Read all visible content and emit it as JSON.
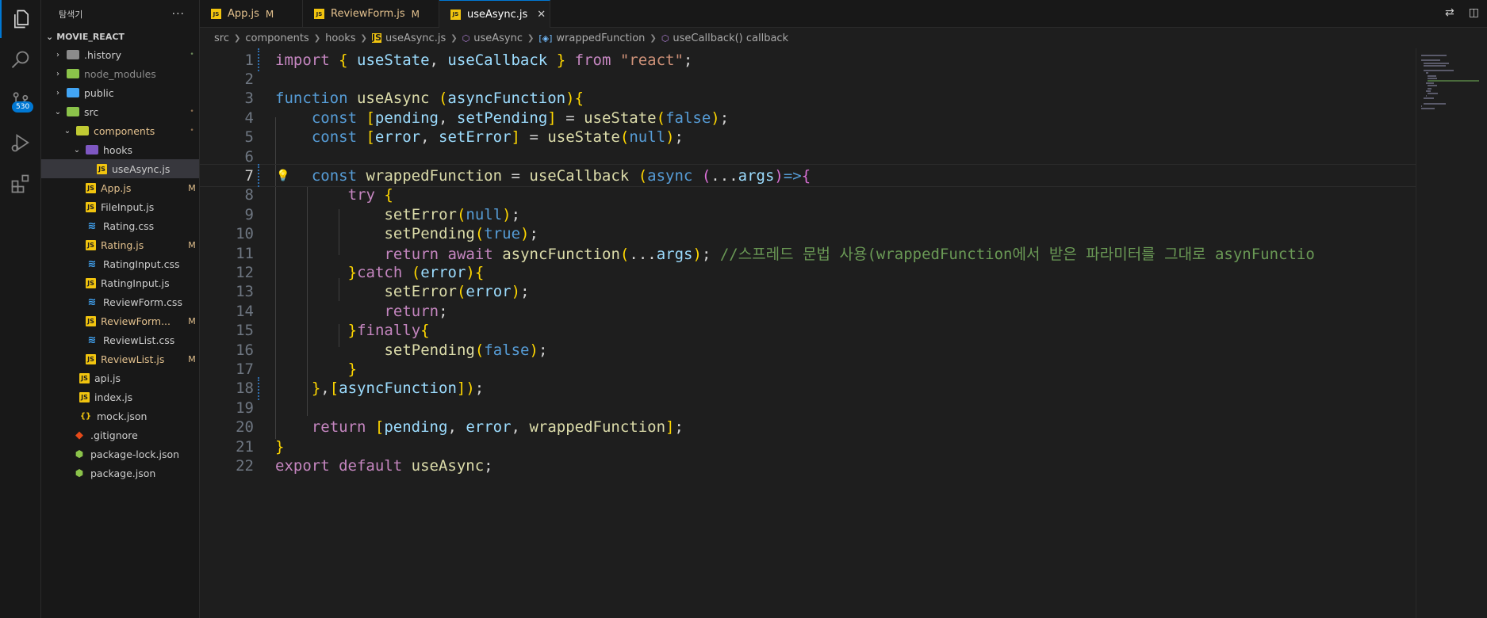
{
  "activity": {
    "badge_count": "530",
    "items": [
      "explorer-icon",
      "search-icon",
      "source-control-icon",
      "run-debug-icon",
      "extensions-icon"
    ]
  },
  "sidebar": {
    "title": "탐색기",
    "more": "···",
    "project": "MOVIE_REACT",
    "items": [
      {
        "label": ".history",
        "type": "folder",
        "status": "•"
      },
      {
        "label": "node_modules",
        "type": "folder",
        "status": ""
      },
      {
        "label": "public",
        "type": "folder",
        "status": ""
      },
      {
        "label": "src",
        "type": "folder",
        "status": "•"
      },
      {
        "label": "components",
        "type": "folder",
        "status": "•"
      },
      {
        "label": "hooks",
        "type": "folder",
        "status": ""
      },
      {
        "label": "useAsync.js",
        "type": "js",
        "status": ""
      },
      {
        "label": "App.js",
        "type": "js",
        "status": "M"
      },
      {
        "label": "FileInput.js",
        "type": "js",
        "status": ""
      },
      {
        "label": "Rating.css",
        "type": "css",
        "status": ""
      },
      {
        "label": "Rating.js",
        "type": "js",
        "status": "M"
      },
      {
        "label": "RatingInput.css",
        "type": "css",
        "status": ""
      },
      {
        "label": "RatingInput.js",
        "type": "js",
        "status": ""
      },
      {
        "label": "ReviewForm.css",
        "type": "css",
        "status": ""
      },
      {
        "label": "ReviewForm...",
        "type": "js",
        "status": "M"
      },
      {
        "label": "ReviewList.css",
        "type": "css",
        "status": ""
      },
      {
        "label": "ReviewList.js",
        "type": "js",
        "status": "M"
      },
      {
        "label": "api.js",
        "type": "js",
        "status": ""
      },
      {
        "label": "index.js",
        "type": "js",
        "status": ""
      },
      {
        "label": "mock.json",
        "type": "json",
        "status": ""
      },
      {
        "label": ".gitignore",
        "type": "git",
        "status": ""
      },
      {
        "label": "package-lock.json",
        "type": "npm",
        "status": ""
      },
      {
        "label": "package.json",
        "type": "npm",
        "status": ""
      }
    ]
  },
  "tabs": [
    {
      "label": "App.js",
      "mark": "M"
    },
    {
      "label": "ReviewForm.js",
      "mark": "M"
    },
    {
      "label": "useAsync.js",
      "close": "✕"
    }
  ],
  "breadcrumb": {
    "parts": [
      "src",
      "components",
      "hooks",
      "useAsync.js",
      "useAsync",
      "wrappedFunction",
      "useCallback() callback"
    ]
  },
  "editor": {
    "current_line": 7,
    "line_numbers": [
      "1",
      "2",
      "3",
      "4",
      "5",
      "6",
      "7",
      "8",
      "9",
      "10",
      "11",
      "12",
      "13",
      "14",
      "15",
      "16",
      "17",
      "18",
      "19",
      "20",
      "21",
      "22"
    ],
    "lines": [
      "import { useState, useCallback } from \"react\";",
      "",
      "function useAsync (asyncFunction){",
      "    const [pending, setPending] = useState(false);",
      "    const [error, setError] = useState(null);",
      "",
      "    const wrappedFunction = useCallback (async (...args)=>{",
      "        try {",
      "            setError(null);",
      "            setPending(true);",
      "            return await asyncFunction(...args); //스프레드 문법 사용(wrappedFunction에서 받은 파라미터를 그대로 asynFunctio",
      "        }catch (error){",
      "            setError(error);",
      "            return;",
      "        }finally{",
      "            setPending(false);",
      "        }",
      "    },[asyncFunction]);",
      "",
      "    return [pending, error, wrappedFunction];",
      "}",
      "export default useAsync;"
    ]
  },
  "colors": {
    "accent": "#0078d4",
    "modified": "#e2c08d",
    "keyword": "#c586c0",
    "storage": "#569cd6",
    "function": "#dcdcaa",
    "variable": "#9cdcfe",
    "string": "#ce9178",
    "comment": "#6a9955"
  }
}
